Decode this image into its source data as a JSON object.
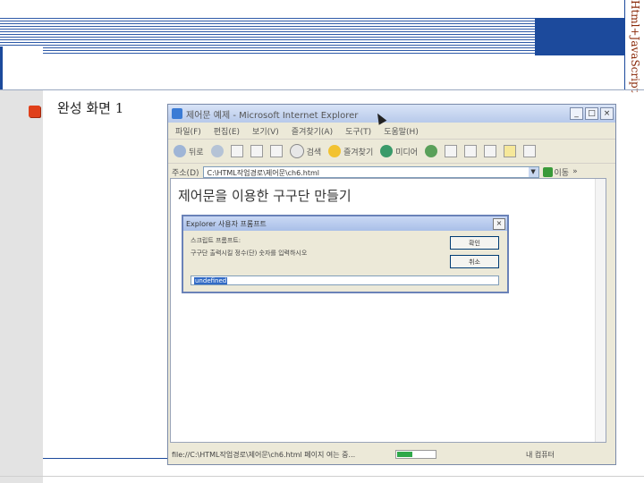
{
  "slide": {
    "vertical_title": "Html+JavaScript",
    "heading": "완성 화면 1"
  },
  "ie_window": {
    "title": "제어문 예제 - Microsoft Internet Explorer",
    "window_buttons": {
      "minimize": "_",
      "maximize": "□",
      "close": "×"
    },
    "menu": [
      "파일(F)",
      "편집(E)",
      "보기(V)",
      "즐겨찾기(A)",
      "도구(T)",
      "도움말(H)"
    ],
    "toolbar": {
      "back_label": "뒤로",
      "search_label": "검색",
      "favorites_label": "즐겨찾기",
      "media_label": "미디어"
    },
    "address": {
      "label": "주소(D)",
      "value": "C:\\HTML작업경로\\제어문\\ch6.html",
      "go_label": "이동",
      "links_label": "»"
    },
    "page": {
      "heading": "제어문을 이용한 구구단 만들기"
    },
    "dialog": {
      "title": "Explorer 사용자 프롬프트",
      "close": "×",
      "line1": "스크립트 프롬프트:",
      "line2": "구구단 출력시킬 정수(단) 숫자를 입력하시오",
      "ok_label": "확인",
      "cancel_label": "취소",
      "input_value": "undefined"
    },
    "status": {
      "text": "file://C:\\HTML작업경로\\제어문\\ch6.html 페이지 여는 중...",
      "progress_fraction": 0.4,
      "zone": "내 컴퓨터"
    }
  },
  "colors": {
    "accent_blue": "#1c4a9c",
    "bullet_red": "#e0401a",
    "title_brown": "#8a2a0a"
  }
}
